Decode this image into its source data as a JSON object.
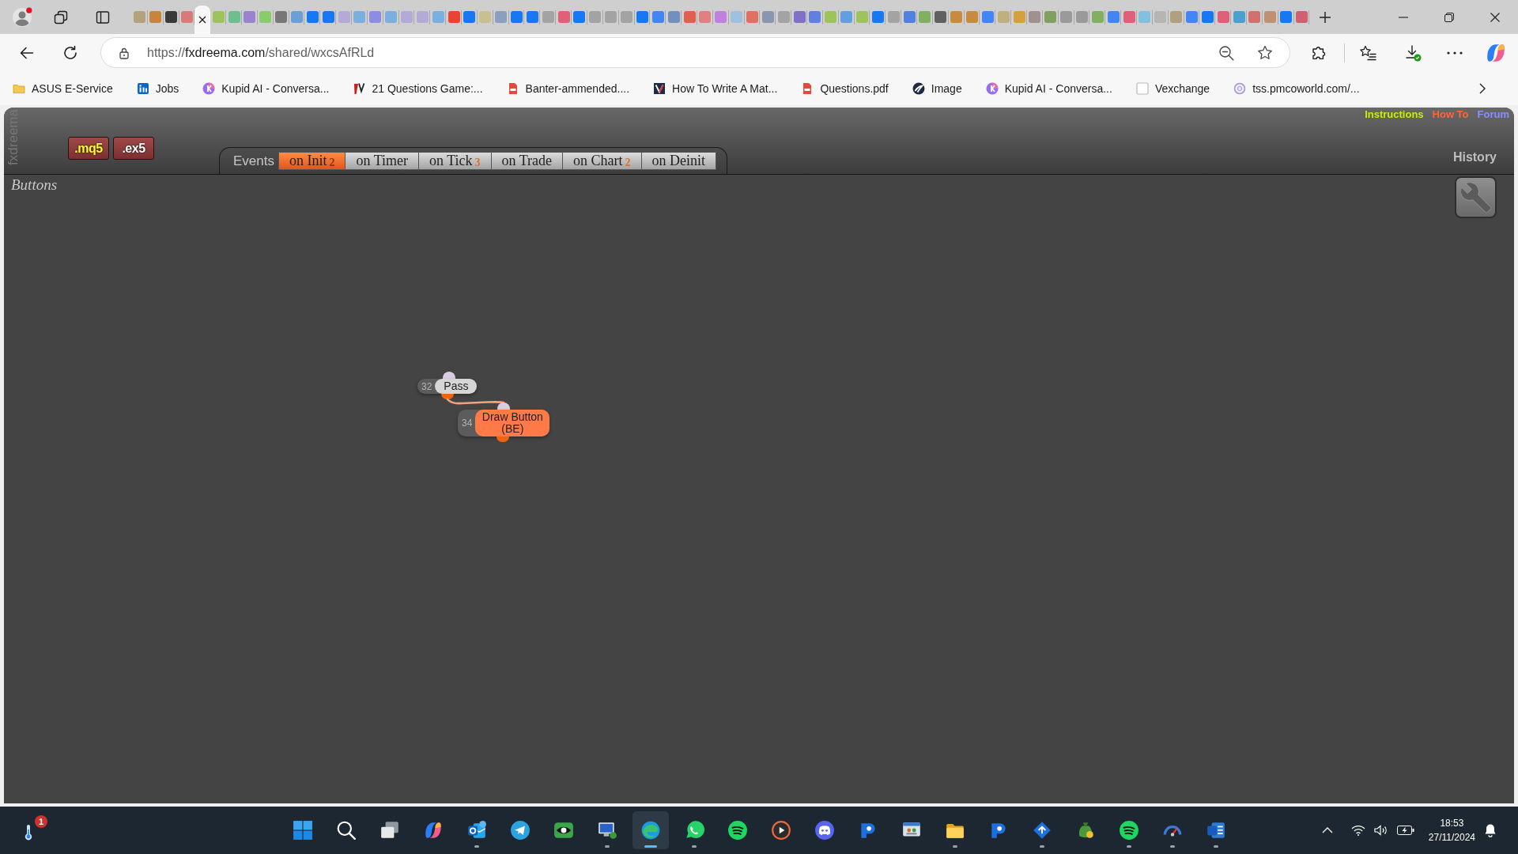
{
  "browser": {
    "tabs": [
      {
        "selected": false,
        "color": "#b4a27c"
      },
      {
        "selected": false,
        "color": "#c8843c"
      },
      {
        "selected": false,
        "color": "#3a3a3a"
      },
      {
        "selected": false,
        "color": "#d87a7a"
      },
      {
        "selected": true
      },
      {
        "selected": false,
        "color": "#9cc45a"
      },
      {
        "selected": false,
        "color": "#6dbf8e"
      },
      {
        "selected": false,
        "color": "#9b82d0"
      },
      {
        "selected": false,
        "color": "#8acb6a"
      },
      {
        "selected": false,
        "color": "#777777"
      },
      {
        "selected": false,
        "color": "#6aa0d8"
      },
      {
        "selected": false,
        "color": "#1877f2"
      },
      {
        "selected": false,
        "color": "#1877f2"
      },
      {
        "selected": false,
        "color": "#b3aad8"
      },
      {
        "selected": false,
        "color": "#7ab0e0"
      },
      {
        "selected": false,
        "color": "#8c8ce0"
      },
      {
        "selected": false,
        "color": "#7ab0e0"
      },
      {
        "selected": false,
        "color": "#b3aad8"
      },
      {
        "selected": false,
        "color": "#b3aad8"
      },
      {
        "selected": false,
        "color": "#7ab0e0"
      },
      {
        "selected": false,
        "color": "#ea4335"
      },
      {
        "selected": false,
        "color": "#1877f2"
      },
      {
        "selected": false,
        "color": "#c8c08e"
      },
      {
        "selected": false,
        "color": "#8aa0c0"
      },
      {
        "selected": false,
        "color": "#1877f2"
      },
      {
        "selected": false,
        "color": "#1877f2"
      },
      {
        "selected": false,
        "color": "#a3a3a3"
      },
      {
        "selected": false,
        "color": "#e0607a"
      },
      {
        "selected": false,
        "color": "#1877f2"
      },
      {
        "selected": false,
        "color": "#a3a3a3"
      },
      {
        "selected": false,
        "color": "#a3a3a3"
      },
      {
        "selected": false,
        "color": "#a3a3a3"
      },
      {
        "selected": false,
        "color": "#1877f2"
      },
      {
        "selected": false,
        "color": "#4285f4"
      },
      {
        "selected": false,
        "color": "#7090c0"
      },
      {
        "selected": false,
        "color": "#e0604f"
      },
      {
        "selected": false,
        "color": "#e08080"
      },
      {
        "selected": false,
        "color": "#c080e0"
      },
      {
        "selected": false,
        "color": "#a0c0e0"
      },
      {
        "selected": false,
        "color": "#e07060"
      },
      {
        "selected": false,
        "color": "#8a96b0"
      },
      {
        "selected": false,
        "color": "#a3a3a3"
      },
      {
        "selected": false,
        "color": "#8070c8"
      },
      {
        "selected": false,
        "color": "#6080e0"
      },
      {
        "selected": false,
        "color": "#9cc45a"
      },
      {
        "selected": false,
        "color": "#60a0e0"
      },
      {
        "selected": false,
        "color": "#9cc45a"
      },
      {
        "selected": false,
        "color": "#1877f2"
      },
      {
        "selected": false,
        "color": "#a3a3a3"
      },
      {
        "selected": false,
        "color": "#5080e0"
      },
      {
        "selected": false,
        "color": "#80b060"
      },
      {
        "selected": false,
        "color": "#606060"
      },
      {
        "selected": false,
        "color": "#c88a40"
      },
      {
        "selected": false,
        "color": "#c88a40"
      },
      {
        "selected": false,
        "color": "#4285f4"
      },
      {
        "selected": false,
        "color": "#c0b080"
      },
      {
        "selected": false,
        "color": "#d4a040"
      },
      {
        "selected": false,
        "color": "#a09090"
      },
      {
        "selected": false,
        "color": "#80a060"
      },
      {
        "selected": false,
        "color": "#9a9a9a"
      },
      {
        "selected": false,
        "color": "#9a9a9a"
      },
      {
        "selected": false,
        "color": "#80b060"
      },
      {
        "selected": false,
        "color": "#4285f4"
      },
      {
        "selected": false,
        "color": "#e0607a"
      },
      {
        "selected": false,
        "color": "#80c0e0"
      },
      {
        "selected": false,
        "color": "#b5b5b5"
      },
      {
        "selected": false,
        "color": "#b0a080"
      },
      {
        "selected": false,
        "color": "#4285f4"
      },
      {
        "selected": false,
        "color": "#1877f2"
      },
      {
        "selected": false,
        "color": "#e0607a"
      },
      {
        "selected": false,
        "color": "#4aa0d0"
      },
      {
        "selected": false,
        "color": "#d07070"
      },
      {
        "selected": false,
        "color": "#c09070"
      },
      {
        "selected": false,
        "color": "#1877f2"
      },
      {
        "selected": false,
        "color": "#d06070"
      }
    ],
    "url": {
      "scheme": "https://",
      "domain": "fxdreema.com",
      "path": "/shared/wxcsAfRLd"
    },
    "bookmarks": [
      {
        "label": "ASUS E-Service"
      },
      {
        "label": "Jobs"
      },
      {
        "label": "Kupid AI - Conversa..."
      },
      {
        "label": "21 Questions Game:..."
      },
      {
        "label": "Banter-ammended...."
      },
      {
        "label": "How To Write A Mat..."
      },
      {
        "label": "Questions.pdf"
      },
      {
        "label": "Image"
      },
      {
        "label": "Kupid AI - Conversa..."
      },
      {
        "label": "Vexchange"
      },
      {
        "label": "tss.pmcoworld.com/..."
      }
    ]
  },
  "app": {
    "brand": "fxdreema",
    "exports": [
      {
        "label": ".mq5",
        "kind": "source"
      },
      {
        "label": ".ex5",
        "kind": "compiled"
      }
    ],
    "events_label": "Events",
    "event_tabs": [
      {
        "label": "on Init",
        "count": "2",
        "selected": true
      },
      {
        "label": "on Timer",
        "selected": false
      },
      {
        "label": "on Tick",
        "count": "3",
        "selected": false
      },
      {
        "label": "on Trade",
        "selected": false
      },
      {
        "label": "on Chart",
        "count": "2",
        "selected": false
      },
      {
        "label": "on Deinit",
        "selected": false
      }
    ],
    "links": [
      {
        "label": "Instructions",
        "color": "#c6f000"
      },
      {
        "label": "How To",
        "color": "#ff6633"
      },
      {
        "label": "Forum",
        "color": "#8c8cff"
      }
    ],
    "history": "History",
    "canvas": {
      "title": "Buttons",
      "nodes": [
        {
          "number": "32",
          "label": "Pass",
          "kind": "pass",
          "linked": true
        },
        {
          "number": "34",
          "label": "Draw Button (BE)",
          "kind": "action"
        }
      ]
    }
  },
  "taskbar": {
    "weather_badge": "1",
    "apps": [
      {
        "running": false,
        "selected": false
      },
      {
        "running": true,
        "selected": false
      },
      {
        "running": false,
        "selected": false
      },
      {
        "running": false,
        "selected": false
      },
      {
        "running": true,
        "selected": false
      },
      {
        "running": true,
        "selected": true
      },
      {
        "running": true,
        "selected": false
      },
      {
        "running": false,
        "selected": false
      },
      {
        "running": false,
        "selected": false
      },
      {
        "running": false,
        "selected": false
      },
      {
        "running": false,
        "selected": false
      },
      {
        "running": false,
        "selected": false
      },
      {
        "running": true,
        "selected": false
      },
      {
        "running": false,
        "selected": false
      },
      {
        "running": true,
        "selected": false
      },
      {
        "running": false,
        "selected": false
      },
      {
        "running": true,
        "selected": false
      },
      {
        "running": true,
        "selected": false
      },
      {
        "running": true,
        "selected": false
      }
    ],
    "time": "18:53",
    "date": "27/11/2024"
  }
}
